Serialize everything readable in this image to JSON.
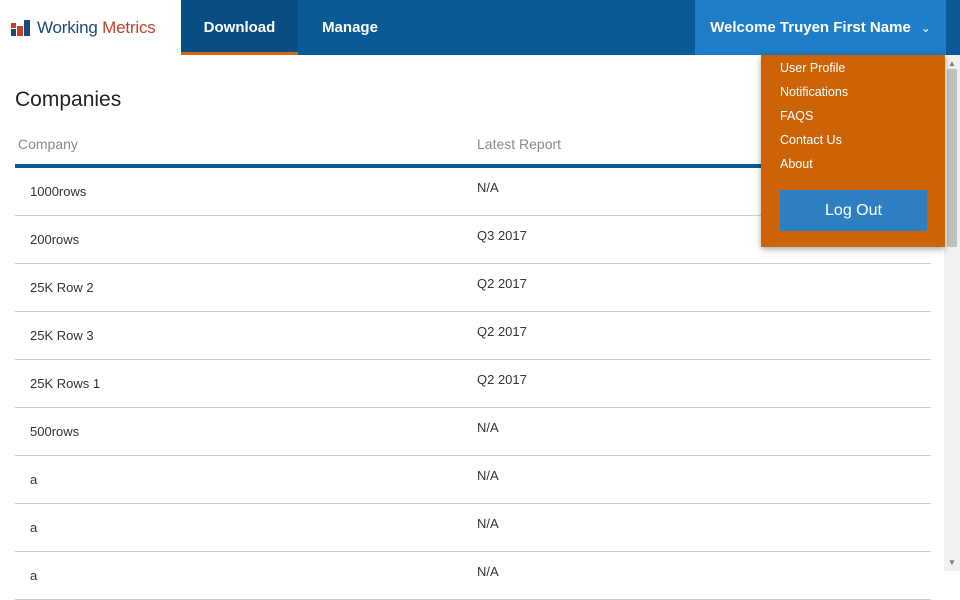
{
  "logo": {
    "text_main": "Working",
    "text_accent": "Metrics"
  },
  "nav": {
    "tabs": [
      {
        "label": "Download"
      },
      {
        "label": "Manage"
      }
    ]
  },
  "user": {
    "welcome": "Welcome Truyen First Name"
  },
  "menu": {
    "items": [
      "User Profile",
      "Notifications",
      "FAQS",
      "Contact Us",
      "About"
    ],
    "logout_label": "Log Out"
  },
  "page": {
    "title": "Companies"
  },
  "table": {
    "columns": [
      "Company",
      "Latest Report"
    ],
    "rows": [
      {
        "company": "1000rows",
        "report": "N/A"
      },
      {
        "company": "200rows",
        "report": "Q3 2017"
      },
      {
        "company": "25K Row 2",
        "report": "Q2 2017"
      },
      {
        "company": "25K Row 3",
        "report": "Q2 2017"
      },
      {
        "company": "25K Rows 1",
        "report": "Q2 2017"
      },
      {
        "company": "500rows",
        "report": "N/A"
      },
      {
        "company": "a",
        "report": "N/A"
      },
      {
        "company": "a",
        "report": "N/A"
      },
      {
        "company": "a",
        "report": "N/A"
      }
    ]
  },
  "colors": {
    "header": "#0a5a96",
    "accent": "#d4690d",
    "welcome": "#1f7ec7",
    "dropdown": "#cc6306",
    "logout": "#2e7fc2"
  },
  "icons": {
    "dropdown": "chevron-down-icon",
    "logo": "working-metrics-logo-icon"
  }
}
